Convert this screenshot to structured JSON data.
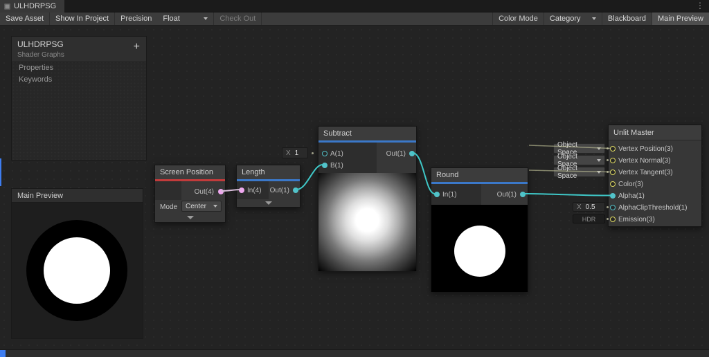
{
  "colors": {
    "accent-blue": "#3B78C9",
    "accent-red": "#C23B3B",
    "wire-cyan": "#3FC8C8",
    "wire-vec4": "#D9BEDB",
    "wire-vec3": "#D3D6A6",
    "port-vec1": "#53C2C9",
    "port-vec3": "#DFDA61",
    "port-vec4": "#EFA8EF",
    "selection-blue": "#3E7DF0"
  },
  "tabbar": {
    "tab_title": "ULHDRPSG",
    "menu_icon": "⋮"
  },
  "toolbar": {
    "save_asset": "Save Asset",
    "show_in_project": "Show In Project",
    "precision_label": "Precision",
    "precision_value": "Float",
    "check_out": "Check Out",
    "color_mode_label": "Color Mode",
    "color_mode_value": "Category",
    "blackboard_button": "Blackboard",
    "main_preview_button": "Main Preview"
  },
  "blackboard": {
    "title": "ULHDRPSG",
    "subtitle": "Shader Graphs",
    "add_button": "+",
    "properties_label": "Properties",
    "keywords_label": "Keywords"
  },
  "main_preview": {
    "title": "Main Preview"
  },
  "nodes": {
    "screen_position": {
      "title": "Screen Position",
      "out_label": "Out(4)",
      "mode_label": "Mode",
      "mode_value": "Center"
    },
    "length": {
      "title": "Length",
      "in_label": "In(4)",
      "out_label": "Out(1)"
    },
    "subtract": {
      "title": "Subtract",
      "a_label": "A(1)",
      "b_label": "B(1)",
      "out_label": "Out(1)",
      "a_field_label": "X",
      "a_field_value": "1"
    },
    "round": {
      "title": "Round",
      "in_label": "In(1)",
      "out_label": "Out(1)"
    },
    "unlit_master": {
      "title": "Unlit Master",
      "object_space": "Object Space",
      "rows": [
        {
          "label": "Vertex Position(3)"
        },
        {
          "label": "Vertex Normal(3)"
        },
        {
          "label": "Vertex Tangent(3)"
        },
        {
          "label": "Color(3)"
        },
        {
          "label": "Alpha(1)"
        },
        {
          "label": "AlphaClipThreshold(1)"
        },
        {
          "label": "Emission(3)"
        }
      ],
      "alpha_clip_field_label": "X",
      "alpha_clip_field_value": "0.5",
      "emission_field_value": "HDR"
    }
  }
}
